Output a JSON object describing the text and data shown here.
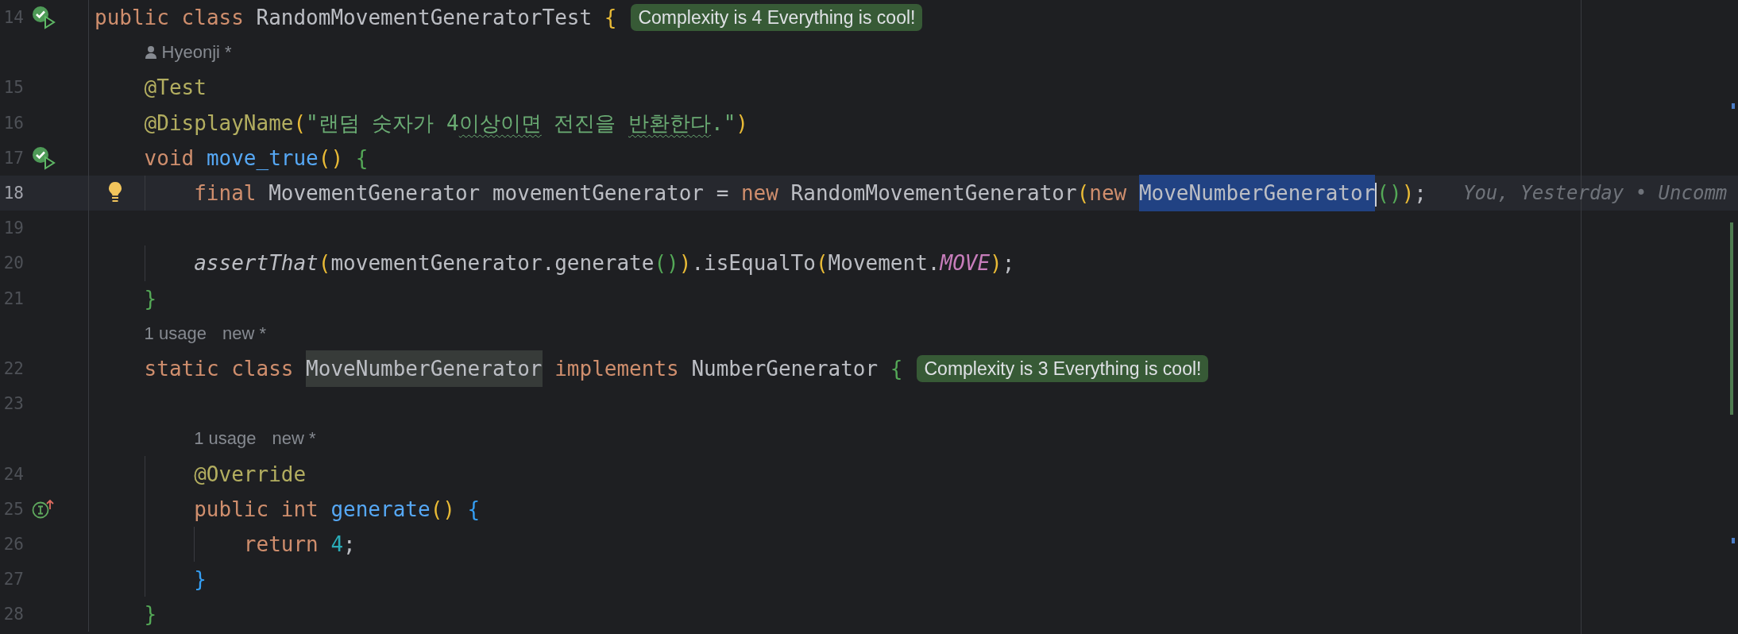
{
  "editor": {
    "rows": [
      {
        "kind": "code",
        "number": "14",
        "current": false,
        "gutter": {
          "kind": "run"
        },
        "indent": "",
        "tokens": [
          {
            "kind": "keyword",
            "text": "public class "
          },
          {
            "kind": "plain",
            "text": "RandomMovementGeneratorTest "
          },
          {
            "kind": "bracket",
            "color": "#e8ba36",
            "text": "{"
          }
        ],
        "badge": "Complexity is 4 Everything is cool!"
      },
      {
        "kind": "author",
        "indent": "    ",
        "text": "Hyeonji *"
      },
      {
        "kind": "code",
        "number": "15",
        "current": false,
        "indent": "    ",
        "tokens": [
          {
            "kind": "annotation",
            "text": "@Test"
          }
        ]
      },
      {
        "kind": "code",
        "number": "16",
        "current": false,
        "indent": "    ",
        "tokens": [
          {
            "kind": "annotation",
            "text": "@DisplayName"
          },
          {
            "kind": "bracket",
            "color": "#e8ba36",
            "text": "("
          },
          {
            "kind": "string",
            "typo": false,
            "text": "\"랜덤 숫자가 4"
          },
          {
            "kind": "string",
            "typo": true,
            "text": "이상이면"
          },
          {
            "kind": "string",
            "typo": false,
            "text": " 전진을 "
          },
          {
            "kind": "string",
            "typo": true,
            "text": "반환한다"
          },
          {
            "kind": "string",
            "typo": false,
            "text": ".\""
          },
          {
            "kind": "bracket",
            "color": "#e8ba36",
            "text": ")"
          }
        ]
      },
      {
        "kind": "code",
        "number": "17",
        "current": false,
        "gutter": {
          "kind": "run"
        },
        "indent": "    ",
        "tokens": [
          {
            "kind": "keyword",
            "text": "void "
          },
          {
            "kind": "function",
            "text": "move_true"
          },
          {
            "kind": "bracket",
            "color": "#e8ba36",
            "text": "()"
          },
          {
            "kind": "bracket",
            "color": "#54a857",
            "text": " {"
          }
        ]
      },
      {
        "kind": "code",
        "number": "18",
        "current": true,
        "gutter": {
          "kind": "intention"
        },
        "indent": "        ",
        "tokens": [
          {
            "kind": "keyword",
            "text": "final "
          },
          {
            "kind": "plain",
            "text": "MovementGenerator movementGenerator = "
          },
          {
            "kind": "keyword",
            "text": "new "
          },
          {
            "kind": "plain",
            "text": "RandomMovementGenerator"
          },
          {
            "kind": "bracket",
            "color": "#e8ba36",
            "text": "("
          },
          {
            "kind": "keyword",
            "text": "new "
          },
          {
            "kind": "selection",
            "text": "MoveNumberGenerator"
          },
          {
            "kind": "caret"
          },
          {
            "kind": "bracket",
            "color": "#54a857",
            "text": "()"
          },
          {
            "kind": "bracket",
            "color": "#e8ba36",
            "text": ")"
          },
          {
            "kind": "plain",
            "text": ";"
          }
        ],
        "inline_hint": "You, Yesterday • Uncomm"
      },
      {
        "kind": "code",
        "number": "19",
        "current": false,
        "indent": "",
        "tokens": []
      },
      {
        "kind": "code",
        "number": "20",
        "current": false,
        "indent": "        ",
        "tokens": [
          {
            "kind": "static-call",
            "text": "assertThat"
          },
          {
            "kind": "bracket",
            "color": "#e8ba36",
            "text": "("
          },
          {
            "kind": "plain",
            "text": "movementGenerator.generate"
          },
          {
            "kind": "bracket",
            "color": "#54a857",
            "text": "()"
          },
          {
            "kind": "bracket",
            "color": "#e8ba36",
            "text": ")"
          },
          {
            "kind": "plain",
            "text": ".isEqualTo"
          },
          {
            "kind": "bracket",
            "color": "#e8ba36",
            "text": "("
          },
          {
            "kind": "plain",
            "text": "Movement."
          },
          {
            "kind": "constant",
            "text": "MOVE"
          },
          {
            "kind": "bracket",
            "color": "#e8ba36",
            "text": ")"
          },
          {
            "kind": "plain",
            "text": ";"
          }
        ]
      },
      {
        "kind": "code",
        "number": "21",
        "current": false,
        "indent": "    ",
        "tokens": [
          {
            "kind": "bracket",
            "color": "#54a857",
            "text": "}"
          }
        ]
      },
      {
        "kind": "usages",
        "indent": "    ",
        "items": [
          "1 usage",
          "new *"
        ]
      },
      {
        "kind": "code",
        "number": "22",
        "current": false,
        "indent": "    ",
        "tokens": [
          {
            "kind": "keyword",
            "text": "static class "
          },
          {
            "kind": "usage-highlight",
            "text": "MoveNumberGenerator"
          },
          {
            "kind": "keyword",
            "text": " implements "
          },
          {
            "kind": "plain",
            "text": "NumberGenerator "
          },
          {
            "kind": "bracket",
            "color": "#54a857",
            "text": "{"
          }
        ],
        "badge": "Complexity is 3 Everything is cool!"
      },
      {
        "kind": "code",
        "number": "23",
        "current": false,
        "indent": "",
        "tokens": []
      },
      {
        "kind": "usages",
        "indent": "        ",
        "items": [
          "1 usage",
          "new *"
        ]
      },
      {
        "kind": "code",
        "number": "24",
        "current": false,
        "indent": "        ",
        "tokens": [
          {
            "kind": "annotation",
            "text": "@Override"
          }
        ]
      },
      {
        "kind": "code",
        "number": "25",
        "current": false,
        "gutter": {
          "kind": "implements"
        },
        "indent": "        ",
        "tokens": [
          {
            "kind": "keyword",
            "text": "public int "
          },
          {
            "kind": "function",
            "text": "generate"
          },
          {
            "kind": "bracket",
            "color": "#e8ba36",
            "text": "()"
          },
          {
            "kind": "bracket",
            "color": "#359ff4",
            "text": " {"
          }
        ]
      },
      {
        "kind": "code",
        "number": "26",
        "current": false,
        "indent": "            ",
        "tokens": [
          {
            "kind": "keyword",
            "text": "return "
          },
          {
            "kind": "number",
            "text": "4"
          },
          {
            "kind": "plain",
            "text": ";"
          }
        ]
      },
      {
        "kind": "code",
        "number": "27",
        "current": false,
        "indent": "        ",
        "tokens": [
          {
            "kind": "bracket",
            "color": "#359ff4",
            "text": "}"
          }
        ]
      },
      {
        "kind": "code",
        "number": "28",
        "current": false,
        "indent": "    ",
        "tokens": [
          {
            "kind": "bracket",
            "color": "#54a857",
            "text": "}"
          }
        ]
      }
    ]
  }
}
